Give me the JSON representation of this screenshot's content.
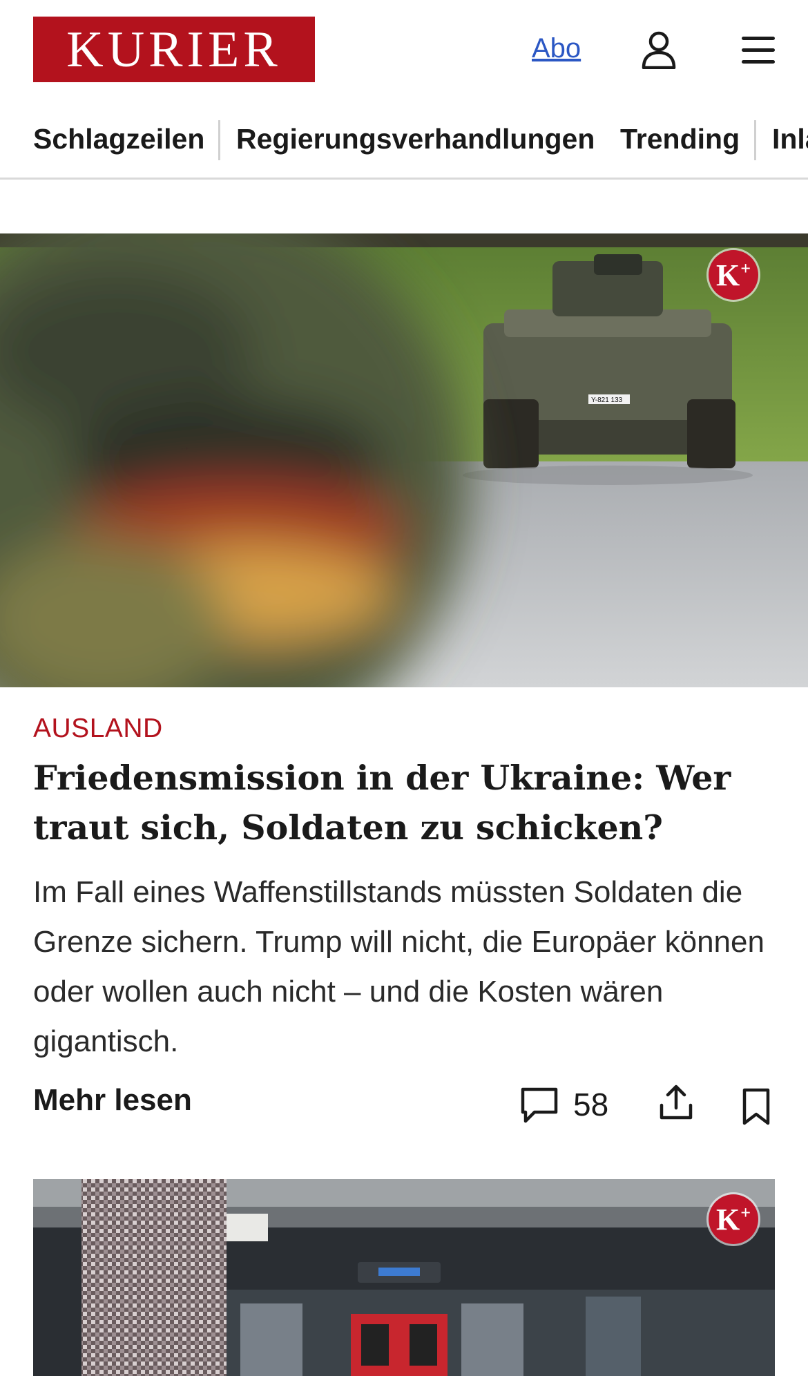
{
  "header": {
    "logo_text": "KURIER",
    "abo_label": "Abo",
    "user_icon": "user-icon",
    "menu_icon": "hamburger-menu-icon"
  },
  "nav": {
    "items": [
      "Schlagzeilen",
      "Regierungsverhandlungen",
      "Trending",
      "Inland"
    ]
  },
  "article": {
    "premium_badge": "K+",
    "category": "AUSLAND",
    "headline": "Friedensmission in der Ukraine: Wer traut sich, Soldaten zu schicken?",
    "teaser": "Im Fall eines Waffenstillstands müssten Soldaten die Grenze sichern. Trump will nicht, die Europäer können oder wollen auch nicht – und die Kosten wären gigantisch.",
    "read_more": "Mehr lesen",
    "comment_count": "58",
    "vehicle_plate": "Y-821 133"
  },
  "second_article": {
    "premium_badge": "K+"
  },
  "colors": {
    "brand_red": "#b3121d",
    "link_blue": "#2b57c4",
    "badge_red": "#c0152a"
  }
}
